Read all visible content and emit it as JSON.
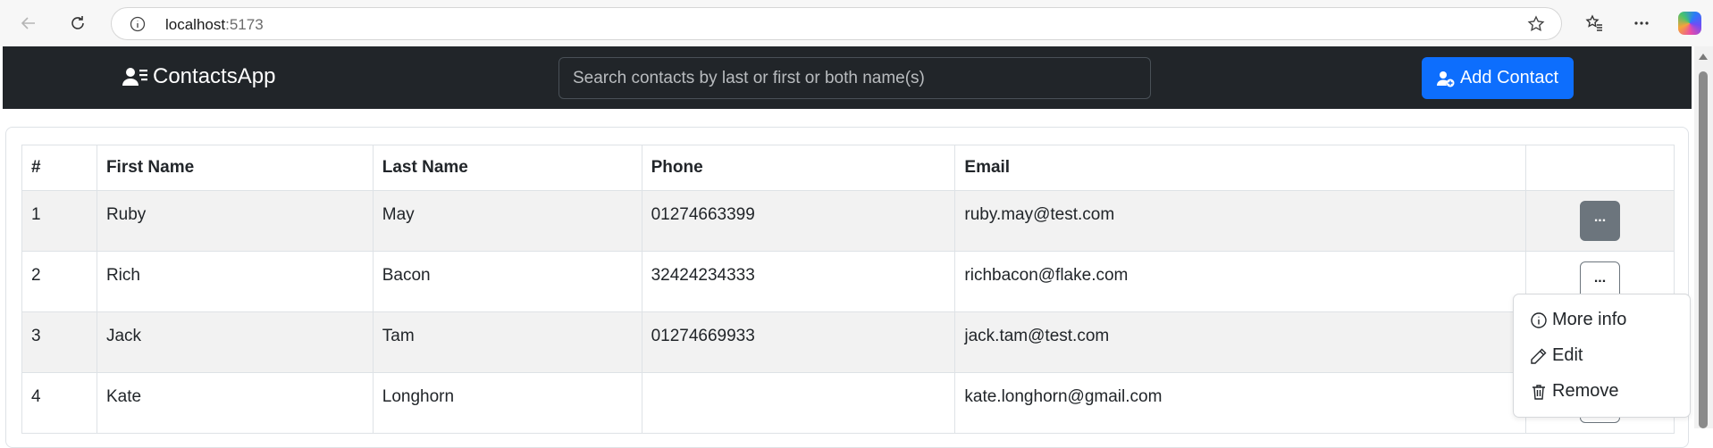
{
  "browser": {
    "host": "localhost",
    "port": ":5173"
  },
  "navbar": {
    "brand": "ContactsApp",
    "search_placeholder": "Search contacts by last or first or both name(s)",
    "add_button_label": "Add Contact"
  },
  "table": {
    "headers": [
      "#",
      "First Name",
      "Last Name",
      "Phone",
      "Email",
      ""
    ],
    "rows": [
      {
        "num": "1",
        "first": "Ruby",
        "last": "May",
        "phone": "01274663399",
        "email": "ruby.may@test.com",
        "action": "..."
      },
      {
        "num": "2",
        "first": "Rich",
        "last": "Bacon",
        "phone": "32424234333",
        "email": "richbacon@flake.com",
        "action": "..."
      },
      {
        "num": "3",
        "first": "Jack",
        "last": "Tam",
        "phone": "01274669933",
        "email": "jack.tam@test.com",
        "action": "..."
      },
      {
        "num": "4",
        "first": "Kate",
        "last": "Longhorn",
        "phone": "",
        "email": "kate.longhorn@gmail.com",
        "action": "..."
      }
    ]
  },
  "dropdown": {
    "items": [
      {
        "label": "More info",
        "icon": "info-circle-icon"
      },
      {
        "label": "Edit",
        "icon": "pencil-icon"
      },
      {
        "label": "Remove",
        "icon": "trash-icon"
      }
    ]
  },
  "colors": {
    "navbar_bg": "#212529",
    "primary": "#0d6efd",
    "secondary": "#6c757d"
  }
}
